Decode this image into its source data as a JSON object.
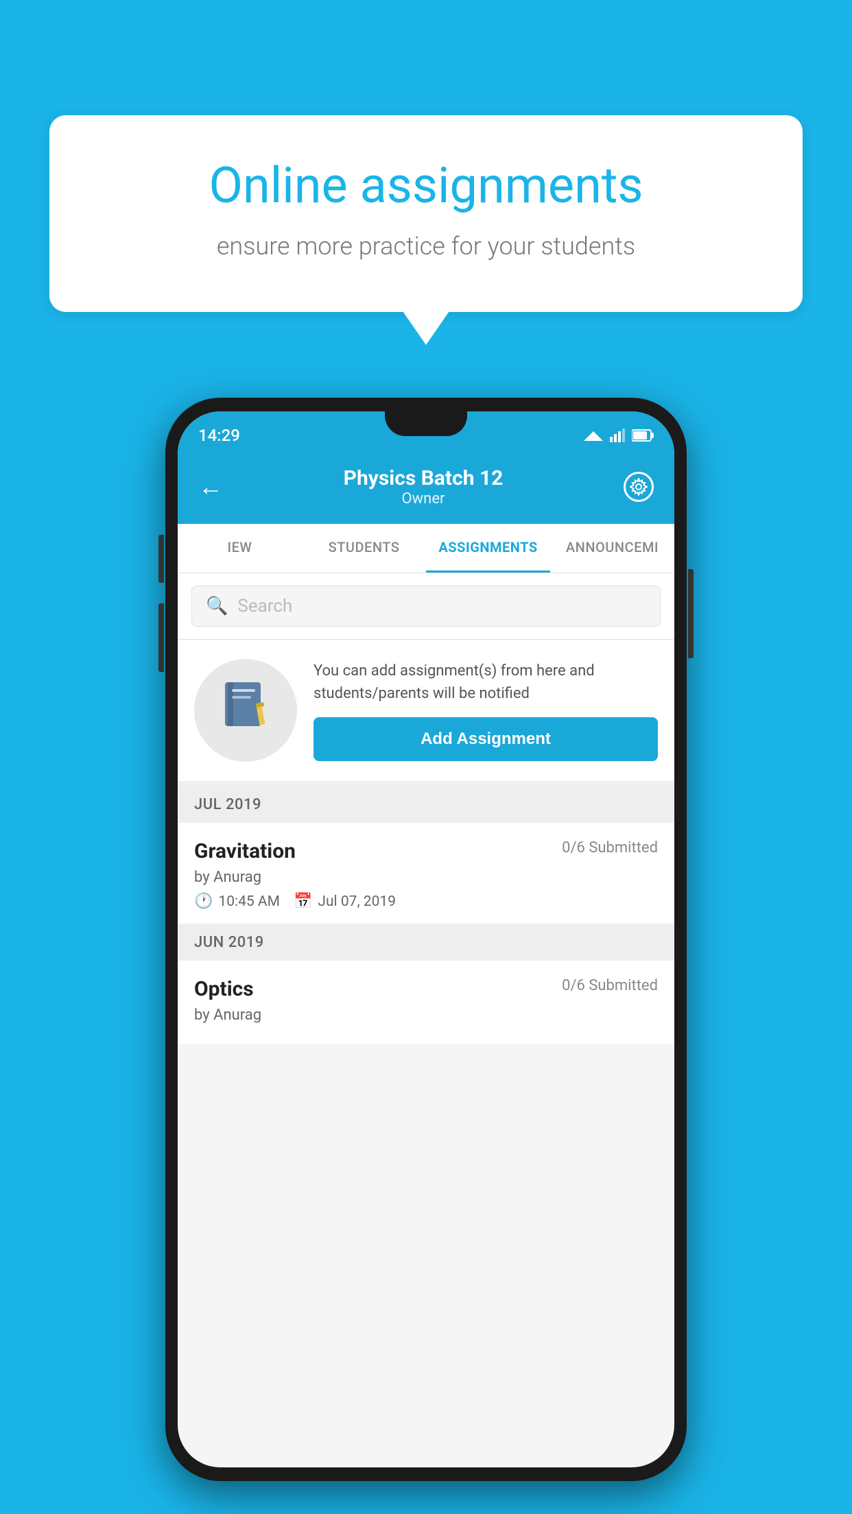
{
  "page": {
    "background_color": "#1ab4e8"
  },
  "speech_bubble": {
    "title": "Online assignments",
    "subtitle": "ensure more practice for your students"
  },
  "status_bar": {
    "time": "14:29"
  },
  "header": {
    "title": "Physics Batch 12",
    "subtitle": "Owner",
    "back_label": "←",
    "settings_label": "⚙"
  },
  "tabs": [
    {
      "label": "IEW",
      "active": false
    },
    {
      "label": "STUDENTS",
      "active": false
    },
    {
      "label": "ASSIGNMENTS",
      "active": true
    },
    {
      "label": "ANNOUNCEMI",
      "active": false
    }
  ],
  "search": {
    "placeholder": "Search"
  },
  "promo": {
    "description": "You can add assignment(s) from here and students/parents will be notified",
    "button_label": "Add Assignment"
  },
  "sections": [
    {
      "month": "JUL 2019",
      "assignments": [
        {
          "name": "Gravitation",
          "submitted": "0/6 Submitted",
          "by": "by Anurag",
          "time": "10:45 AM",
          "date": "Jul 07, 2019"
        }
      ]
    },
    {
      "month": "JUN 2019",
      "assignments": [
        {
          "name": "Optics",
          "submitted": "0/6 Submitted",
          "by": "by Anurag",
          "time": "",
          "date": ""
        }
      ]
    }
  ]
}
